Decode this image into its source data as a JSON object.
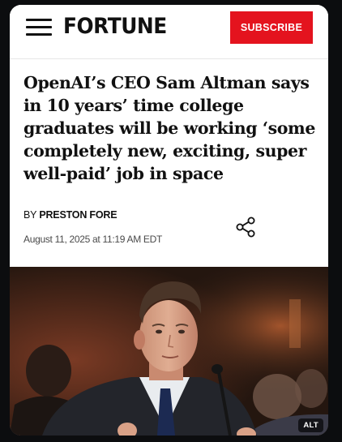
{
  "header": {
    "logo_text": "FORTUNE",
    "subscribe_label": "SUBSCRIBE",
    "menu_icon": "hamburger-menu-icon"
  },
  "article": {
    "headline": "OpenAI’s CEO Sam Altman says in 10 years’ time college graduates will be working ‘some completely new, exciting, super well-paid’ job in space",
    "byline_prefix": "BY",
    "author": "PRESTON FORE",
    "date": "August 11, 2025 at 11:19 AM EDT",
    "share_icon": "share-icon"
  },
  "media": {
    "alt_badge": "ALT"
  },
  "colors": {
    "brand_red": "#e4131e",
    "page_background": "#0c0d0f",
    "card_background": "#ffffff",
    "text_primary": "#111111",
    "text_secondary": "#4a4a4a"
  }
}
